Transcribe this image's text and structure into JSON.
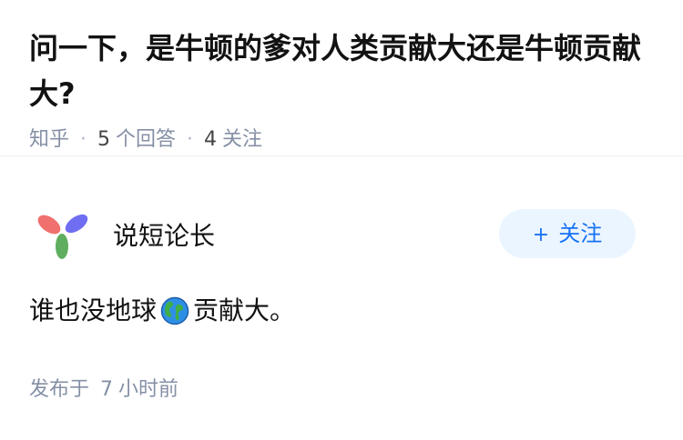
{
  "question": {
    "title": "问一下，是牛顿的爹对人类贡献大还是牛顿贡献大?",
    "source": "知乎",
    "answer_count": "5",
    "answer_label": "个回答",
    "follow_count": "4",
    "follow_label": "关注"
  },
  "answer": {
    "author_name": "说短论长",
    "follow_button_label": "关注",
    "content_before": "谁也没地球",
    "content_icon": "earth-globe-icon",
    "content_after": "贡献大。",
    "time_prefix": "发布于",
    "time_value": "7",
    "time_unit": "小时前"
  },
  "colors": {
    "accent": "#1772f6",
    "follow_bg": "#ebf5ff",
    "meta_gray": "#8590a6",
    "text": "#121212"
  }
}
